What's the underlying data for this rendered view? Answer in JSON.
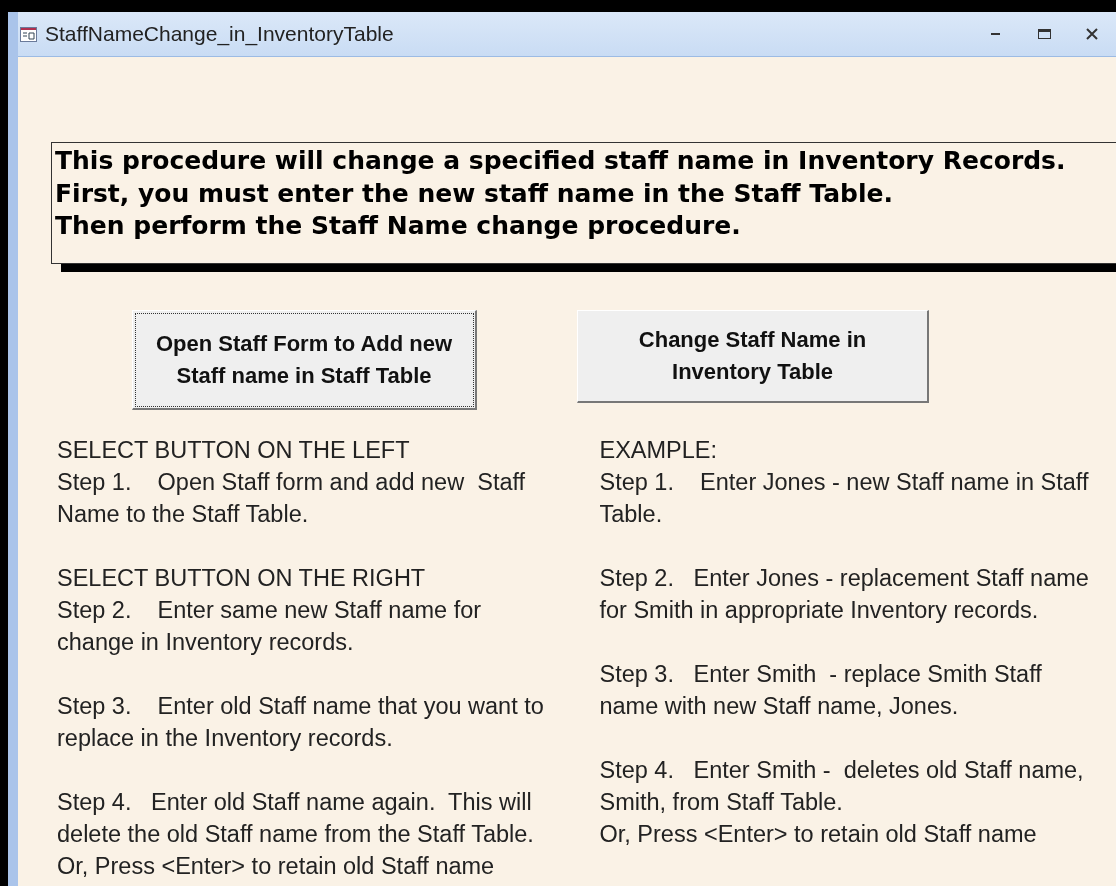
{
  "window": {
    "title": "StaffNameChange_in_InventoryTable",
    "controls": [
      {
        "kind": "minimize"
      },
      {
        "kind": "maximize"
      },
      {
        "kind": "close"
      }
    ]
  },
  "notice": {
    "lines": [
      "This procedure will change a specified staff name in Inventory Records.",
      "First, you must enter the new staff name in the Staff Table.",
      "Then perform the Staff Name change procedure."
    ]
  },
  "buttons": [
    {
      "lines": [
        "Open Staff Form to Add new",
        "Staff name in Staff Table"
      ],
      "focused": true
    },
    {
      "lines": [
        "Change Staff Name in",
        "Inventory Table"
      ],
      "focused": false
    }
  ],
  "columns": [
    {
      "paragraphs": [
        {
          "lines": [
            "SELECT BUTTON ON THE LEFT",
            "Step 1.    Open Staff form and add new  Staff",
            "Name to the Staff Table."
          ]
        },
        {
          "lines": [
            "SELECT BUTTON ON THE RIGHT",
            "Step 2.    Enter same new Staff name for",
            "change in Inventory records."
          ]
        },
        {
          "lines": [
            "Step 3.    Enter old Staff name that you want to",
            "replace in the Inventory records."
          ]
        },
        {
          "lines": [
            "Step 4.   Enter old Staff name again.  This will",
            "delete the old Staff name from the Staff Table.",
            "Or, Press <Enter> to retain old Staff name"
          ]
        }
      ]
    },
    {
      "paragraphs": [
        {
          "lines": [
            "EXAMPLE:",
            "Step 1.    Enter Jones - new Staff name in Staff",
            "Table."
          ]
        },
        {
          "lines": [
            "Step 2.   Enter Jones - replacement Staff name",
            "for Smith in appropriate Inventory records."
          ]
        },
        {
          "lines": [
            "Step 3.   Enter Smith  - replace Smith Staff",
            "name with new Staff name, Jones."
          ]
        },
        {
          "lines": [
            "Step 4.   Enter Smith -  deletes old Staff name,",
            "Smith, from Staff Table.",
            "Or, Press <Enter> to retain old Staff name"
          ]
        }
      ]
    }
  ]
}
